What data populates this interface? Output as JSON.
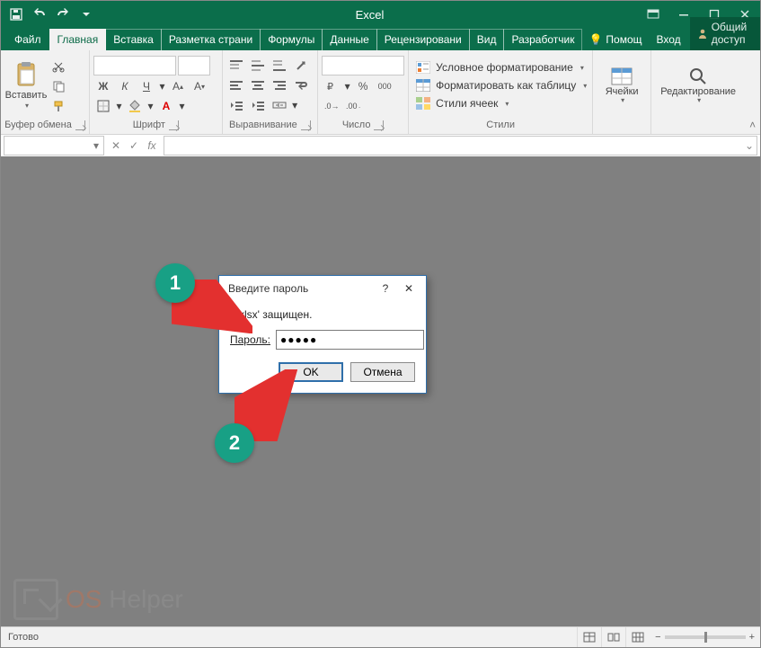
{
  "app": {
    "title": "Excel"
  },
  "window_buttons": {
    "share": "Общий доступ"
  },
  "tabs": {
    "file": "Файл",
    "home": "Главная",
    "insert": "Вставка",
    "layout": "Разметка страни",
    "formulas": "Формулы",
    "data": "Данные",
    "review": "Рецензировани",
    "view": "Вид",
    "developer": "Разработчик",
    "help": "Помощ",
    "signin": "Вход"
  },
  "ribbon": {
    "clipboard": {
      "paste": "Вставить",
      "label": "Буфер обмена"
    },
    "font": {
      "label": "Шрифт",
      "bold": "Ж",
      "italic": "К",
      "underline": "Ч"
    },
    "alignment": {
      "label": "Выравнивание"
    },
    "number": {
      "label": "Число",
      "percent": "%",
      "thousands": "000"
    },
    "styles": {
      "label": "Стили",
      "conditional": "Условное форматирование",
      "format_table": "Форматировать как таблицу",
      "cell_styles": "Стили ячеек"
    },
    "cells": {
      "label": "Ячейки"
    },
    "editing": {
      "label": "Редактирование"
    }
  },
  "formula_bar": {
    "fx": "fx",
    "cancel": "✕",
    "enter": "✓"
  },
  "dialog": {
    "title": "Введите пароль",
    "message": "a.xlsx' защищен.",
    "password_label": "Пароль:",
    "password_value": "●●●●●",
    "ok": "OK",
    "cancel": "Отмена"
  },
  "status": {
    "ready": "Готово",
    "zoom_minus": "−",
    "zoom_plus": "+"
  },
  "annotations": {
    "one": "1",
    "two": "2"
  },
  "watermark": {
    "os": "OS",
    "helper": "Helper"
  },
  "colors": {
    "accent": "#0b6e4b",
    "badge": "#18a085",
    "arrow": "#e3302f",
    "dialog_border": "#2f6faa"
  }
}
